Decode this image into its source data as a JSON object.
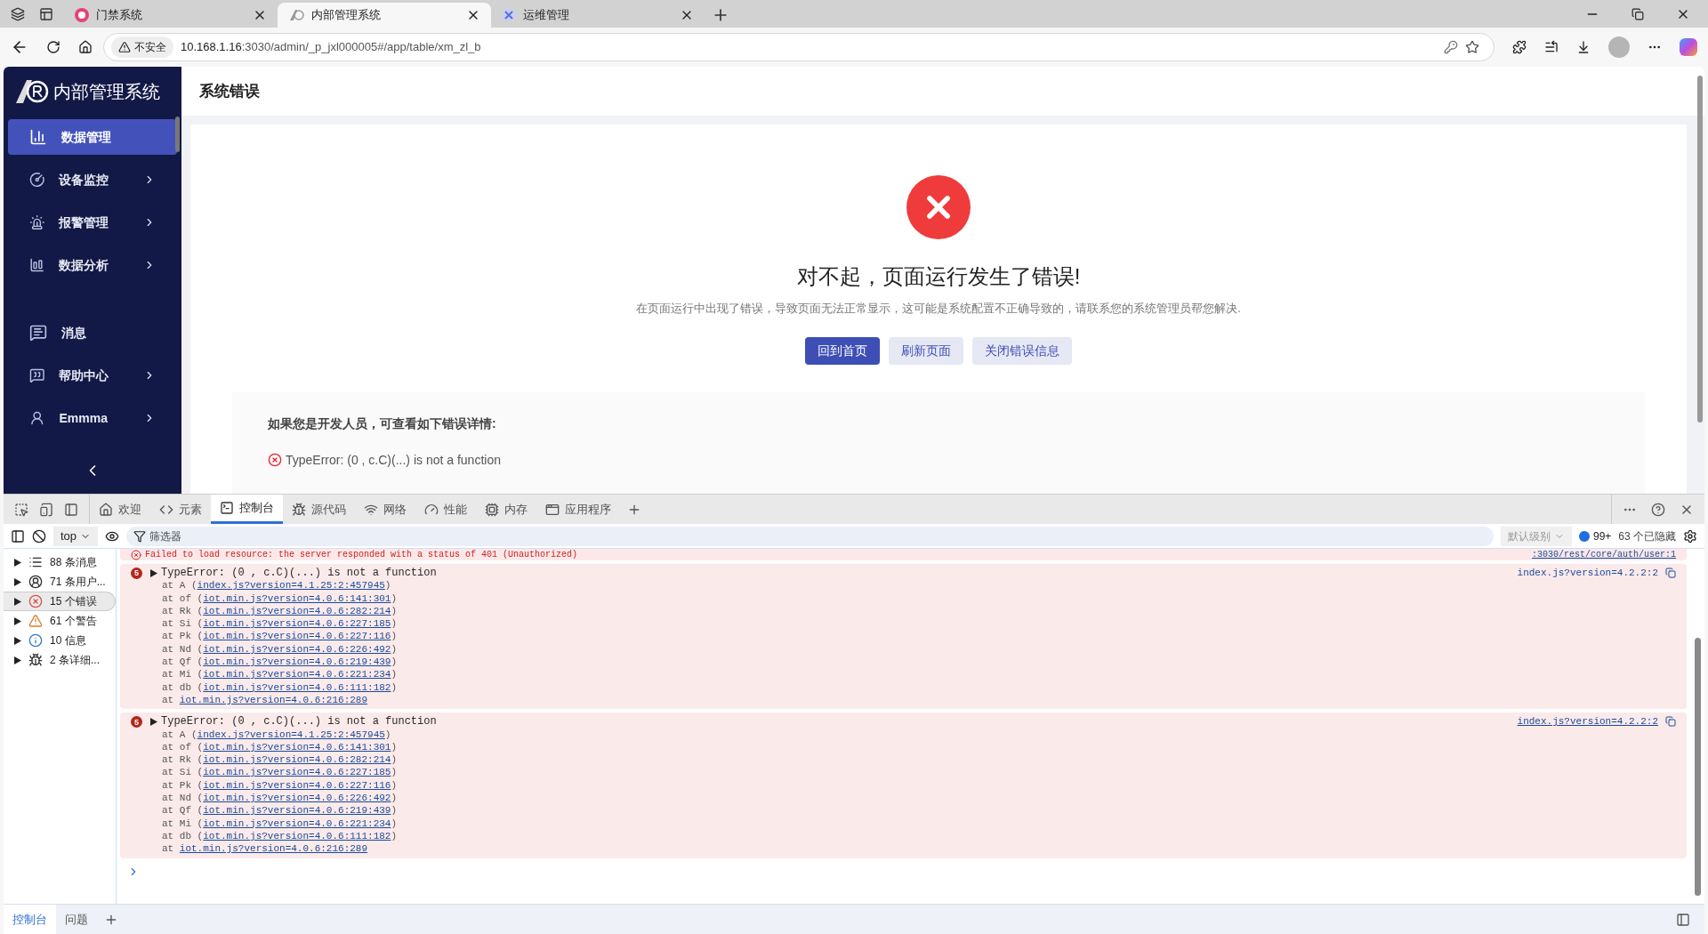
{
  "browser": {
    "tabs": [
      {
        "title": "门禁系统",
        "selected": false
      },
      {
        "title": "内部管理系统",
        "selected": true
      },
      {
        "title": "运维管理",
        "selected": false
      }
    ],
    "security": "不安全",
    "url_host": "10.168.1.16",
    "url_rest": ":3030/admin/_p_jxl000005#/app/table/xm_zl_b"
  },
  "app": {
    "logo_text": "内部管理系统",
    "page_title": "系统错误",
    "menu": [
      {
        "label": "数据管理",
        "selected": true,
        "submenu": false
      },
      {
        "label": "设备监控",
        "selected": false,
        "submenu": true
      },
      {
        "label": "报警管理",
        "selected": false,
        "submenu": true
      },
      {
        "label": "数据分析",
        "selected": false,
        "submenu": true
      },
      {
        "label": "消息",
        "selected": false,
        "submenu": false
      },
      {
        "label": "帮助中心",
        "selected": false,
        "submenu": true
      },
      {
        "label": "Emmma",
        "selected": false,
        "submenu": true
      }
    ],
    "error": {
      "title": "对不起，页面运行发生了错误!",
      "description": "在页面运行中出现了错误，导致页面无法正常显示，这可能是系统配置不正确导致的，请联系您的系统管理员帮您解决.",
      "buttons": [
        {
          "label": "回到首页",
          "kind": "primary"
        },
        {
          "label": "刷新页面",
          "kind": "secondary"
        },
        {
          "label": "关闭错误信息",
          "kind": "secondary"
        }
      ],
      "details_heading": "如果您是开发人员，可查看如下错误详情:",
      "details_message": "TypeError: (0 , c.C)(...) is not a function"
    }
  },
  "devtools": {
    "tabs": [
      {
        "label": "欢迎",
        "selected": false
      },
      {
        "label": "元素",
        "selected": false
      },
      {
        "label": "控制台",
        "selected": true
      },
      {
        "label": "源代码",
        "selected": false
      },
      {
        "label": "网络",
        "selected": false
      },
      {
        "label": "性能",
        "selected": false
      },
      {
        "label": "内存",
        "selected": false
      },
      {
        "label": "应用程序",
        "selected": false
      }
    ],
    "context": "top",
    "filter_placeholder": "筛选器",
    "level": "默认级别",
    "issues_count": "99+",
    "hidden": "63 个已隐藏",
    "groups": [
      {
        "label": "88 条消息",
        "selected": false
      },
      {
        "label": "71 条用户...",
        "selected": false
      },
      {
        "label": "15 个错误",
        "selected": true
      },
      {
        "label": "61 个警告",
        "selected": false
      },
      {
        "label": "10 信息",
        "selected": false
      },
      {
        "label": "2 条详细...",
        "selected": false
      }
    ],
    "failed": {
      "message": "Failed to load resource: the server responded with a status of 401 (Unauthorized)",
      "source": ":3030/rest/core/auth/user:1"
    },
    "errors": [
      {
        "count": "5",
        "message": "TypeError: (0 , c.C)(...) is not a function",
        "source": "index.js?version=4.2.2:2",
        "frames": [
          {
            "lead": "at A (",
            "link": "index.js?version=4.1.25:2:457945",
            "tail": ")"
          },
          {
            "lead": "at of (",
            "link": "iot.min.js?version=4.0.6:141:301",
            "tail": ")"
          },
          {
            "lead": "at Rk (",
            "link": "iot.min.js?version=4.0.6:282:214",
            "tail": ")"
          },
          {
            "lead": "at Si (",
            "link": "iot.min.js?version=4.0.6:227:185",
            "tail": ")"
          },
          {
            "lead": "at Pk (",
            "link": "iot.min.js?version=4.0.6:227:116",
            "tail": ")"
          },
          {
            "lead": "at Nd (",
            "link": "iot.min.js?version=4.0.6:226:492",
            "tail": ")"
          },
          {
            "lead": "at Qf (",
            "link": "iot.min.js?version=4.0.6:219:439",
            "tail": ")"
          },
          {
            "lead": "at Mi (",
            "link": "iot.min.js?version=4.0.6:221:234",
            "tail": ")"
          },
          {
            "lead": "at db (",
            "link": "iot.min.js?version=4.0.6:111:182",
            "tail": ")"
          },
          {
            "lead": "at ",
            "link": "iot.min.js?version=4.0.6:216:289"
          }
        ]
      },
      {
        "count": "5",
        "message": "TypeError: (0 , c.C)(...) is not a function",
        "source": "index.js?version=4.2.2:2",
        "frames": [
          {
            "lead": "at A (",
            "link": "index.js?version=4.1.25:2:457945",
            "tail": ")"
          },
          {
            "lead": "at of (",
            "link": "iot.min.js?version=4.0.6:141:301",
            "tail": ")"
          },
          {
            "lead": "at Rk (",
            "link": "iot.min.js?version=4.0.6:282:214",
            "tail": ")"
          },
          {
            "lead": "at Si (",
            "link": "iot.min.js?version=4.0.6:227:185",
            "tail": ")"
          },
          {
            "lead": "at Pk (",
            "link": "iot.min.js?version=4.0.6:227:116",
            "tail": ")"
          },
          {
            "lead": "at Nd (",
            "link": "iot.min.js?version=4.0.6:226:492",
            "tail": ")"
          },
          {
            "lead": "at Qf (",
            "link": "iot.min.js?version=4.0.6:219:439",
            "tail": ")"
          },
          {
            "lead": "at Mi (",
            "link": "iot.min.js?version=4.0.6:221:234",
            "tail": ")"
          },
          {
            "lead": "at db (",
            "link": "iot.min.js?version=4.0.6:111:182",
            "tail": ")"
          },
          {
            "lead": "at ",
            "link": "iot.min.js?version=4.0.6:216:289"
          }
        ]
      }
    ],
    "drawer_tabs": [
      {
        "label": "控制台",
        "selected": true
      },
      {
        "label": "问题",
        "selected": false
      }
    ]
  }
}
